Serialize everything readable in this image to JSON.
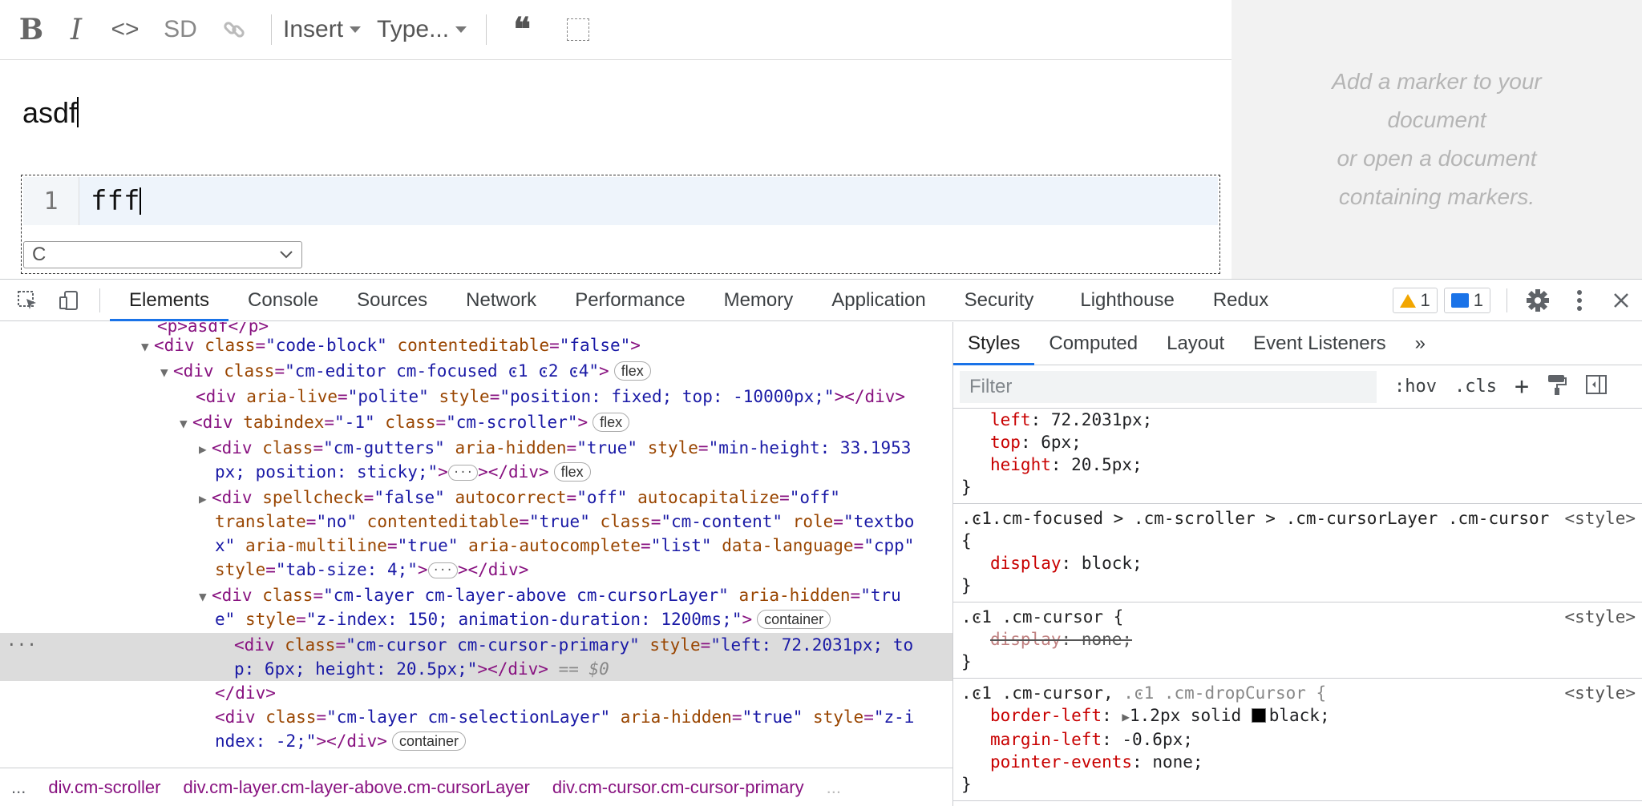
{
  "toolbar": {
    "bold": "B",
    "italic": "I",
    "code": "<>",
    "sd": "SD",
    "insert": "Insert",
    "type": "Type...",
    "quote": "❝"
  },
  "doc": {
    "paragraph": "asdf",
    "code_line_number": "1",
    "code_text": "fff",
    "language": "C"
  },
  "side_panel": {
    "line1": "Add a marker to your",
    "line2": "document",
    "line3": "or open a document",
    "line4": "containing markers."
  },
  "devtools": {
    "tabs": [
      "Elements",
      "Console",
      "Sources",
      "Network",
      "Performance",
      "Memory",
      "Application",
      "Security",
      "Lighthouse",
      "Redux"
    ],
    "warnings": "1",
    "messages": "1",
    "breadcrumbs": [
      "...",
      "div.cm-scroller",
      "div.cm-layer.cm-layer-above.cm-cursorLayer",
      "div.cm-cursor.cm-cursor-primary",
      "..."
    ],
    "styles_tabs": [
      "Styles",
      "Computed",
      "Layout",
      "Event Listeners",
      "»"
    ],
    "filter_placeholder": "Filter",
    "hov": ":hov",
    "cls": ".cls",
    "plus": "+",
    "elements": {
      "l0": "<p>asdf</p>",
      "l1_tag": "<div ",
      "l1_an": "class",
      "l1_av": "\"code-block\"",
      "l1_an2": " contenteditable",
      "l1_av2": "\"false\"",
      "l1_end": ">",
      "l2_tag": "<div ",
      "l2_an": "class",
      "l2_av": "\"cm-editor cm-focused ͼ1 ͼ2 ͼ4\"",
      "l2_end": ">",
      "l2_pill": "flex",
      "l3_tag": "<div ",
      "l3_an": "aria-live",
      "l3_av": "\"polite\"",
      "l3_an2": " style",
      "l3_av2": "\"position: fixed; top: -10000px;\"",
      "l3_end": "></div>",
      "l4_tag": "<div ",
      "l4_an": "tabindex",
      "l4_av": "\"-1\"",
      "l4_an2": " class",
      "l4_av2": "\"cm-scroller\"",
      "l4_end": ">",
      "l4_pill": "flex",
      "l5_tag": "<div ",
      "l5_an": "class",
      "l5_av": "\"cm-gutters\"",
      "l5_an2": " aria-hidden",
      "l5_av2": "\"true\"",
      "l5_an3": " style",
      "l5_av3": "\"min-height: 33.1953",
      "l6_av": "px; position: sticky;\"",
      "l6_end": "></div>",
      "l6_pill": "flex",
      "l7_tag": "<div ",
      "l7_an": "spellcheck",
      "l7_av": "\"false\"",
      "l7_an2": " autocorrect",
      "l7_av2": "\"off\"",
      "l7_an3": " autocapitalize",
      "l7_av3": "\"off\"",
      "l8_an": "translate",
      "l8_av": "\"no\"",
      "l8_an2": " contenteditable",
      "l8_av2": "\"true\"",
      "l8_an3": " class",
      "l8_av3": "\"cm-content\"",
      "l8_an4": " role",
      "l8_av4": "\"textbo",
      "l9_av": "x\"",
      "l9_an": " aria-multiline",
      "l9_av2": "\"true\"",
      "l9_an2": " aria-autocomplete",
      "l9_av3": "\"list\"",
      "l9_an3": " data-language",
      "l9_av4": "\"cpp\"",
      "l10_an": "style",
      "l10_av": "\"tab-size: 4;\"",
      "l10_end": "></div>",
      "l11_tag": "<div ",
      "l11_an": "class",
      "l11_av": "\"cm-layer cm-layer-above cm-cursorLayer\"",
      "l11_an2": " aria-hidden",
      "l11_av2": "\"tru",
      "l12_av": "e\"",
      "l12_an": " style",
      "l12_av2": "\"z-index: 150; animation-duration: 1200ms;\"",
      "l12_end": ">",
      "l12_pill": "container",
      "l13_tag": "<div ",
      "l13_an": "class",
      "l13_av": "\"cm-cursor cm-cursor-primary\"",
      "l13_an2": " style",
      "l13_av2": "\"left: 72.2031px; to",
      "l14_av": "p: 6px; height: 20.5px;\"",
      "l14_end": "></div>",
      "l14_eq": " == ",
      "l14_dollar": "$0",
      "l15": "</div>",
      "l16_tag": "<div ",
      "l16_an": "class",
      "l16_av": "\"cm-layer cm-selectionLayer\"",
      "l16_an2": " aria-hidden",
      "l16_av2": "\"true\"",
      "l16_an3": " style",
      "l16_av3": "\"z-i",
      "l17_av": "ndex: -2;\"",
      "l17_end": "></div>",
      "l17_pill": "container",
      "gutter_dots": "···"
    },
    "styles": {
      "r0_d1_n": "left",
      "r0_d1_v": "72.2031px;",
      "r0_d2_n": "top",
      "r0_d2_v": "6px;",
      "r0_d3_n": "height",
      "r0_d3_v": "20.5px;",
      "close": "}",
      "r1_sel": ".ͼ1.cm-focused > .cm-scroller > .cm-cursorLayer .cm-cursor {",
      "r1_src": "<style>",
      "r1_d1_n": "display",
      "r1_d1_v": "block;",
      "r2_sel": ".ͼ1 .cm-cursor {",
      "r2_src": "<style>",
      "r2_d1_n": "display",
      "r2_d1_v": "none;",
      "r3_sel_a": ".ͼ1 .cm-cursor, ",
      "r3_sel_b": ".ͼ1 .cm-dropCursor {",
      "r3_src": "<style>",
      "r3_d1_n": "border-left",
      "r3_d1_v": "1.2px solid ",
      "r3_d1_v2": "black;",
      "r3_d2_n": "margin-left",
      "r3_d2_v": "-0.6px;",
      "r3_d3_n": "pointer-events",
      "r3_d3_v": "none;"
    }
  }
}
